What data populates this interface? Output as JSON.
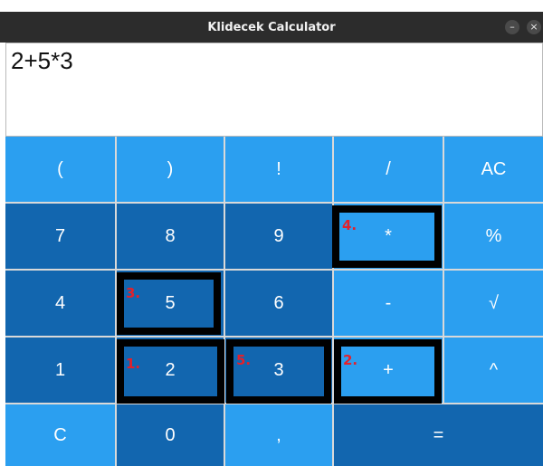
{
  "window": {
    "title": "Klidecek Calculator",
    "minimize_symbol": "–",
    "close_symbol": "×"
  },
  "display": {
    "expression": "2+5*3"
  },
  "keys": {
    "paren_open": "(",
    "paren_close": ")",
    "factorial": "!",
    "divide": "/",
    "all_clear": "AC",
    "seven": "7",
    "eight": "8",
    "nine": "9",
    "multiply": "*",
    "percent": "%",
    "four": "4",
    "five": "5",
    "six": "6",
    "minus": "-",
    "sqrt": "√",
    "one": "1",
    "two": "2",
    "three": "3",
    "plus": "+",
    "power": "^",
    "clear": "C",
    "zero": "0",
    "comma": ",",
    "equals": "="
  },
  "annotations": {
    "step1": "1.",
    "step2": "2.",
    "step3": "3.",
    "step4": "4.",
    "step5": "5."
  },
  "colors": {
    "key_light": "#2b9ff0",
    "key_dark": "#1266af",
    "titlebar": "#2c2c2c",
    "annotation_text": "#e4202a",
    "annotation_border": "#000000"
  }
}
